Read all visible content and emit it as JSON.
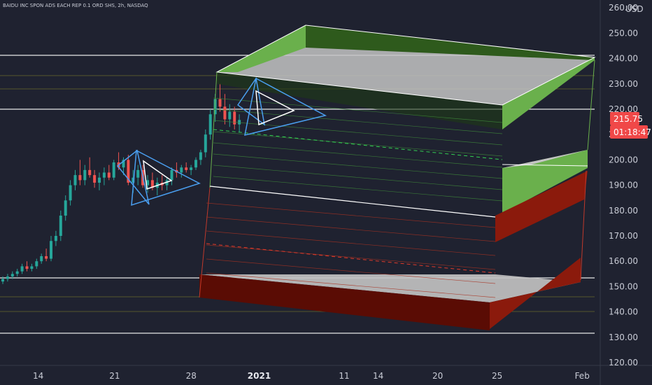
{
  "chart_data": {
    "type": "candlestick",
    "title": "BAIDU INC SPON ADS EACH REP 0.1 ORD SHS, 2h, NASDAQ",
    "currency": "USD",
    "y_ticks": [
      120,
      130,
      140,
      150,
      160,
      170,
      180,
      190,
      200,
      210,
      220,
      230,
      240,
      250,
      260
    ],
    "y_tick_labels": [
      "120.00",
      "130.00",
      "140.00",
      "150.00",
      "160.00",
      "170.00",
      "180.00",
      "190.00",
      "200.00",
      "210.00",
      "220.00",
      "230.00",
      "240.00",
      "250.00",
      "260.00"
    ],
    "ylim": [
      118,
      264
    ],
    "x_ticks": [
      {
        "label": "14",
        "index": 4,
        "bold": false
      },
      {
        "label": "21",
        "index": 13,
        "bold": false
      },
      {
        "label": "28",
        "index": 22,
        "bold": false
      },
      {
        "label": "2021",
        "index": 30,
        "bold": true
      },
      {
        "label": "11",
        "index": 40,
        "bold": false
      },
      {
        "label": "14",
        "index": 44,
        "bold": false
      },
      {
        "label": "20",
        "index": 51,
        "bold": false
      },
      {
        "label": "25",
        "index": 58,
        "bold": false
      },
      {
        "label": "Feb",
        "index": 68,
        "bold": false
      }
    ],
    "x_slots": 70,
    "last_price": "215.75",
    "countdown": "01:18:47",
    "bullish_color": "#26a69a",
    "bearish_color": "#ef5350",
    "candles": [
      [
        152,
        154,
        151,
        153
      ],
      [
        153,
        155,
        152,
        154
      ],
      [
        154,
        156,
        153,
        155
      ],
      [
        155,
        157,
        154,
        156
      ],
      [
        156,
        159,
        155,
        158
      ],
      [
        158,
        160,
        156,
        157
      ],
      [
        157,
        159,
        156,
        158
      ],
      [
        158,
        161,
        157,
        160
      ],
      [
        160,
        163,
        159,
        162
      ],
      [
        162,
        165,
        160,
        161
      ],
      [
        161,
        170,
        160,
        168
      ],
      [
        168,
        172,
        166,
        170
      ],
      [
        170,
        180,
        168,
        178
      ],
      [
        178,
        186,
        176,
        184
      ],
      [
        184,
        192,
        182,
        190
      ],
      [
        190,
        196,
        188,
        194
      ],
      [
        194,
        200,
        190,
        192
      ],
      [
        192,
        198,
        190,
        196
      ],
      [
        196,
        201,
        193,
        194
      ],
      [
        194,
        196,
        189,
        191
      ],
      [
        191,
        195,
        188,
        193
      ],
      [
        193,
        197,
        190,
        195
      ],
      [
        195,
        198,
        192,
        193
      ],
      [
        193,
        200,
        192,
        199
      ],
      [
        199,
        203,
        196,
        197
      ],
      [
        197,
        201,
        194,
        200
      ],
      [
        200,
        202,
        190,
        191
      ],
      [
        191,
        196,
        187,
        193
      ],
      [
        193,
        198,
        190,
        196
      ],
      [
        196,
        198,
        189,
        190
      ],
      [
        190,
        194,
        187,
        192
      ],
      [
        192,
        195,
        188,
        189
      ],
      [
        189,
        193,
        186,
        191
      ],
      [
        191,
        194,
        188,
        190
      ],
      [
        190,
        193,
        188,
        192
      ],
      [
        192,
        197,
        190,
        196
      ],
      [
        196,
        199,
        193,
        195
      ],
      [
        195,
        198,
        193,
        197
      ],
      [
        197,
        199,
        195,
        196
      ],
      [
        196,
        198,
        194,
        197
      ],
      [
        197,
        201,
        196,
        200
      ],
      [
        200,
        204,
        198,
        203
      ],
      [
        203,
        212,
        201,
        210
      ],
      [
        210,
        220,
        208,
        218
      ],
      [
        218,
        226,
        215,
        224
      ],
      [
        224,
        230,
        219,
        221
      ],
      [
        221,
        226,
        214,
        216
      ],
      [
        216,
        222,
        213,
        219
      ],
      [
        219,
        221,
        212,
        214
      ],
      [
        214,
        218,
        211,
        215.75
      ]
    ]
  },
  "overlay_colors": {
    "green": "#6ab04c",
    "dark_green": "#2e5a1c",
    "red": "#8b1a0c",
    "dark_red": "#5a0c04",
    "gray": "#c4c4c4",
    "blue": "#4a9ff0",
    "white": "#ffffff",
    "price_tag": "#f04848"
  }
}
